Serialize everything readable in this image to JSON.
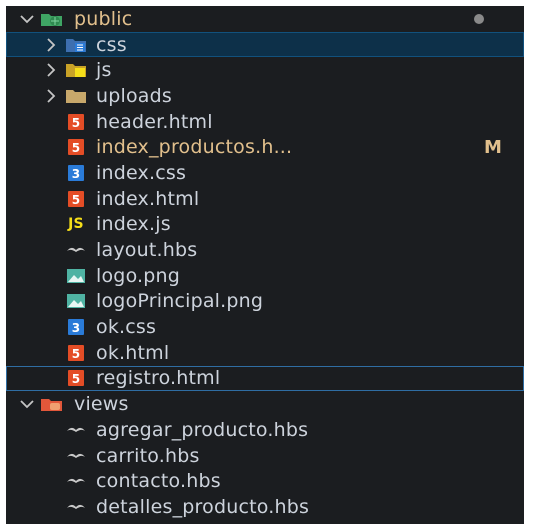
{
  "explorer": {
    "public_folder": {
      "label": "public"
    },
    "children": [
      {
        "label": "css",
        "icon": "css-folder-icon"
      },
      {
        "label": "js",
        "icon": "js-folder-icon"
      },
      {
        "label": "uploads",
        "icon": "folder-icon"
      },
      {
        "label": "header.html",
        "icon": "html-file-icon"
      },
      {
        "label": "index_productos.h...",
        "icon": "html-file-icon",
        "status": "M"
      },
      {
        "label": "index.css",
        "icon": "css-file-icon"
      },
      {
        "label": "index.html",
        "icon": "html-file-icon"
      },
      {
        "label": "index.js",
        "icon": "js-file-icon",
        "icon_text": "JS"
      },
      {
        "label": "layout.hbs",
        "icon": "handlebars-file-icon"
      },
      {
        "label": "logo.png",
        "icon": "image-file-icon"
      },
      {
        "label": "logoPrincipal.png",
        "icon": "image-file-icon"
      },
      {
        "label": "ok.css",
        "icon": "css-file-icon"
      },
      {
        "label": "ok.html",
        "icon": "html-file-icon"
      },
      {
        "label": "registro.html",
        "icon": "html-file-icon"
      }
    ],
    "views_folder": {
      "label": "views"
    },
    "views_children": [
      {
        "label": "agregar_producto.hbs",
        "icon": "handlebars-file-icon"
      },
      {
        "label": "carrito.hbs",
        "icon": "handlebars-file-icon"
      },
      {
        "label": "contacto.hbs",
        "icon": "handlebars-file-icon"
      },
      {
        "label": "detalles_producto.hbs",
        "icon": "handlebars-file-icon"
      }
    ],
    "colors": {
      "background": "#1b1d20",
      "selected": "#0d3049",
      "modified": "#e2c08d",
      "html": "#e44d26",
      "css": "#2a7bd8",
      "js": "#f5de19",
      "image": "#4fb3a3"
    }
  }
}
